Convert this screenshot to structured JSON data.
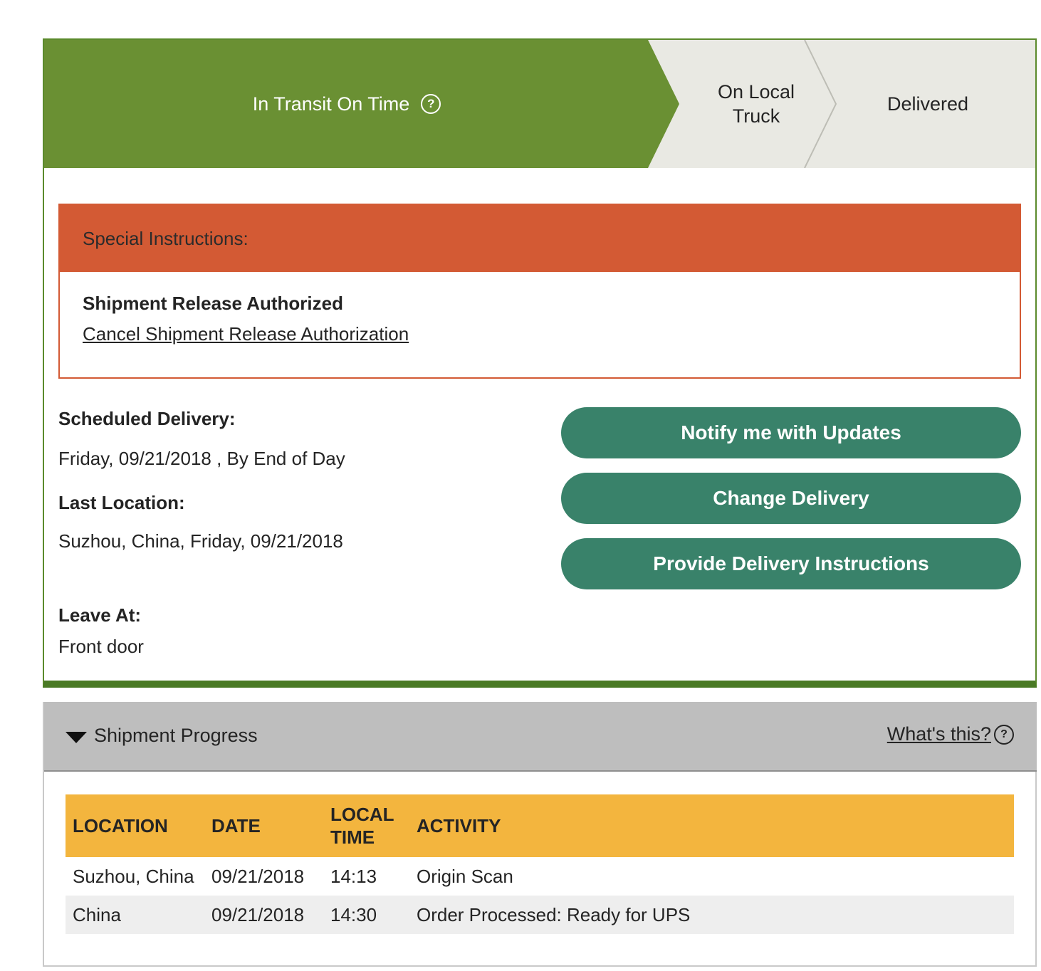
{
  "status_steps": {
    "current": "In Transit On Time",
    "current_help_icon": "question-circle-icon",
    "next": "On Local Truck",
    "final": "Delivered"
  },
  "special_instructions": {
    "heading": "Special Instructions:",
    "title": "Shipment Release Authorized",
    "cancel_link": "Cancel Shipment Release Authorization"
  },
  "delivery_info": {
    "scheduled_label": "Scheduled Delivery:",
    "scheduled_value": "Friday, 09/21/2018 , By End of Day",
    "last_location_label": "Last Location:",
    "last_location_value": "Suzhou, China, Friday, 09/21/2018",
    "leave_at_label": "Leave At:",
    "leave_at_value": "Front door"
  },
  "actions": {
    "notify": "Notify me with Updates",
    "change": "Change Delivery",
    "provide": "Provide Delivery Instructions"
  },
  "shipment_progress": {
    "title": "Shipment Progress",
    "whats_this": "What's this?",
    "columns": [
      "LOCATION",
      "DATE",
      "LOCAL TIME",
      "ACTIVITY"
    ],
    "rows": [
      [
        "Suzhou,  China",
        "09/21/2018",
        "14:13",
        "Origin Scan"
      ],
      [
        "China",
        "09/21/2018",
        "14:30",
        "Order Processed: Ready for UPS"
      ]
    ]
  },
  "colors": {
    "current_step": "#6a9033",
    "inactive_step": "#e9e9e3",
    "special_header": "#d35a34",
    "button": "#39826a",
    "table_header": "#f3b53e"
  }
}
